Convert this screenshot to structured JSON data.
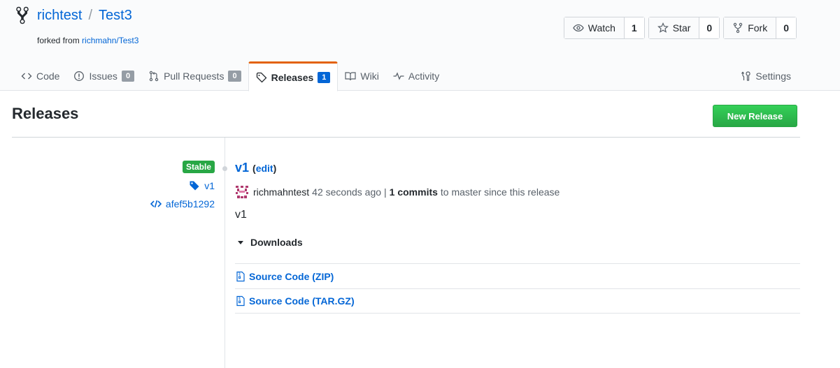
{
  "repo": {
    "owner": "richtest",
    "name": "Test3",
    "separator": "/",
    "forked_prefix": "forked from",
    "forked_source": "richmahn/Test3"
  },
  "actions": {
    "watch_label": "Watch",
    "watch_count": "1",
    "star_label": "Star",
    "star_count": "0",
    "fork_label": "Fork",
    "fork_count": "0"
  },
  "tabs": {
    "code": "Code",
    "issues": "Issues",
    "issues_count": "0",
    "pulls": "Pull Requests",
    "pulls_count": "0",
    "releases": "Releases",
    "releases_count": "1",
    "wiki": "Wiki",
    "activity": "Activity",
    "settings": "Settings"
  },
  "page": {
    "title": "Releases",
    "new_release": "New Release"
  },
  "release": {
    "stable_label": "Stable",
    "tag": "v1",
    "commit": "afef5b1292",
    "title": "v1",
    "edit_open": "(",
    "edit_label": "edit",
    "edit_close": ")",
    "author": "richmahntest",
    "time": "42 seconds ago",
    "pipe": "|",
    "commits": "1 commits",
    "commits_suffix": "to master since this release",
    "body": "v1",
    "downloads_label": "Downloads",
    "downloads": [
      "Source Code (ZIP)",
      "Source Code (TAR.GZ)"
    ]
  },
  "colors": {
    "link": "#0366d6",
    "active_tab": "#e36209",
    "success": "#28a745"
  }
}
